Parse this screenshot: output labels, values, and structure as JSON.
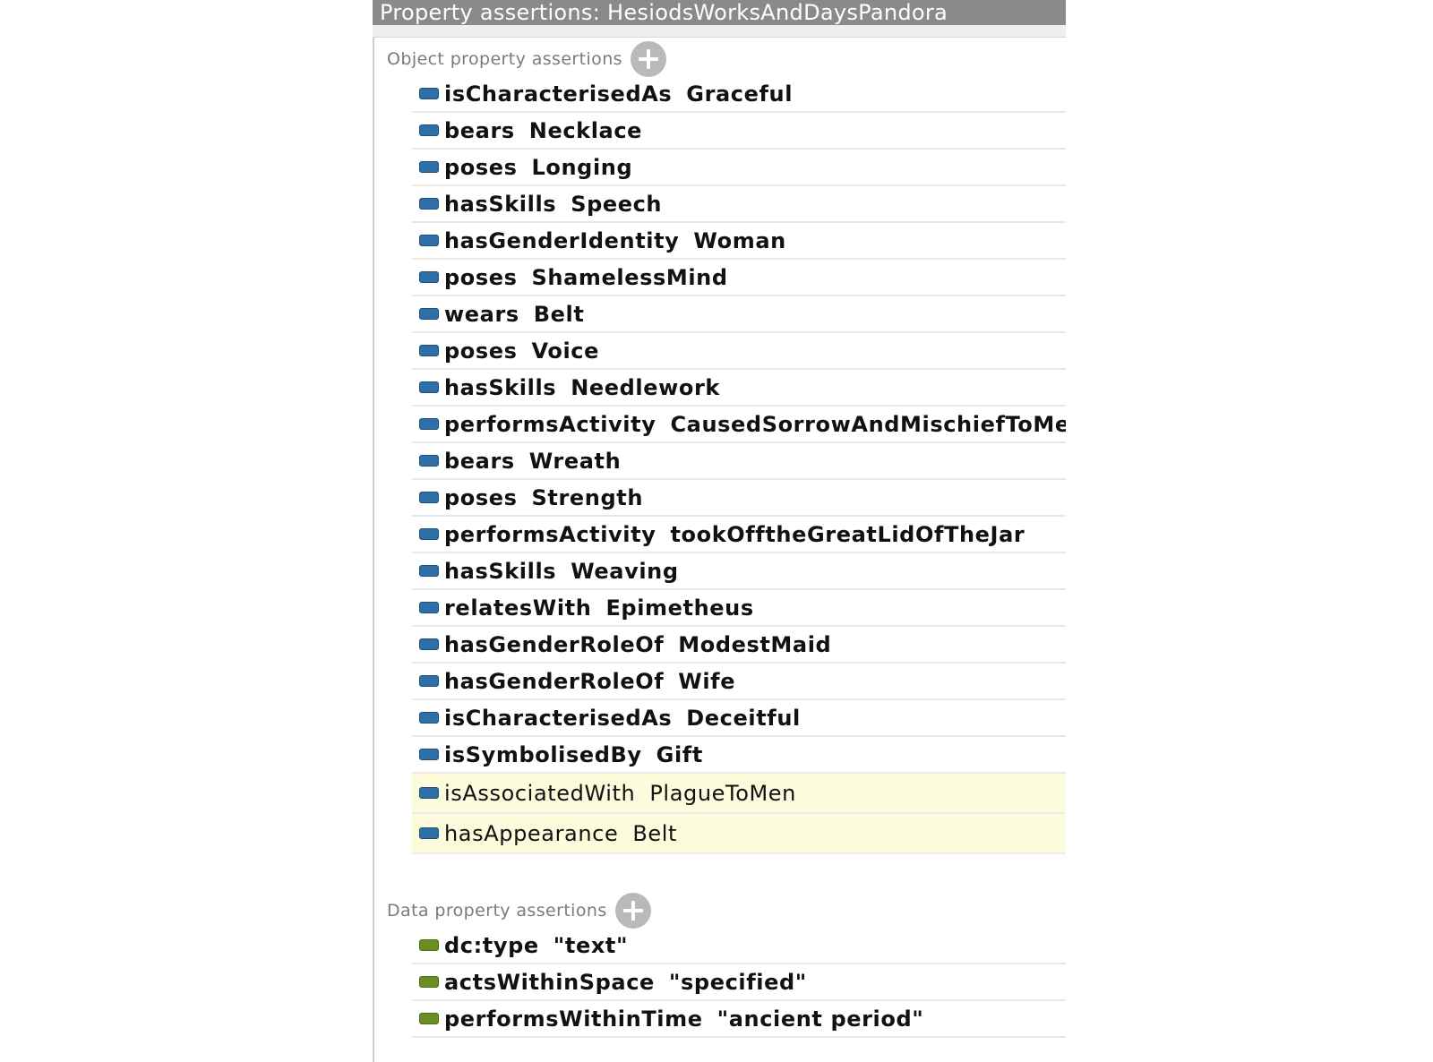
{
  "title": "Property assertions: HesiodsWorksAndDaysPandora",
  "object_section": {
    "label": "Object property assertions",
    "items": [
      {
        "property": "isCharacterisedAs",
        "value": "Graceful"
      },
      {
        "property": "bears",
        "value": "Necklace"
      },
      {
        "property": "poses",
        "value": "Longing"
      },
      {
        "property": "hasSkills",
        "value": "Speech"
      },
      {
        "property": "hasGenderIdentity",
        "value": "Woman"
      },
      {
        "property": "poses",
        "value": "ShamelessMind"
      },
      {
        "property": "wears",
        "value": "Belt"
      },
      {
        "property": "poses",
        "value": "Voice"
      },
      {
        "property": "hasSkills",
        "value": "Needlework"
      },
      {
        "property": "performsActivity",
        "value": "CausedSorrowAndMischiefToMen"
      },
      {
        "property": "bears",
        "value": "Wreath"
      },
      {
        "property": "poses",
        "value": "Strength"
      },
      {
        "property": "performsActivity",
        "value": "tookOfftheGreatLidOfTheJar"
      },
      {
        "property": "hasSkills",
        "value": "Weaving"
      },
      {
        "property": "relatesWith",
        "value": "Epimetheus"
      },
      {
        "property": "hasGenderRoleOf",
        "value": "ModestMaid"
      },
      {
        "property": "hasGenderRoleOf",
        "value": "Wife"
      },
      {
        "property": "isCharacterisedAs",
        "value": "Deceitful"
      },
      {
        "property": "isSymbolisedBy",
        "value": "Gift"
      }
    ],
    "inferred_items": [
      {
        "property": "isAssociatedWith",
        "value": "PlagueToMen"
      },
      {
        "property": "hasAppearance",
        "value": "Belt"
      }
    ]
  },
  "data_section": {
    "label": "Data property assertions",
    "items": [
      {
        "property": "dc:type",
        "value": "\"text\""
      },
      {
        "property": "actsWithinSpace",
        "value": "\"specified\""
      },
      {
        "property": "performsWithinTime",
        "value": "\"ancient period\""
      }
    ]
  },
  "colors": {
    "object_icon": "#2f6fa8",
    "data_icon": "#6b8e23",
    "inferred_background": "#fcfcdc",
    "title_background": "#8a8a8a"
  }
}
